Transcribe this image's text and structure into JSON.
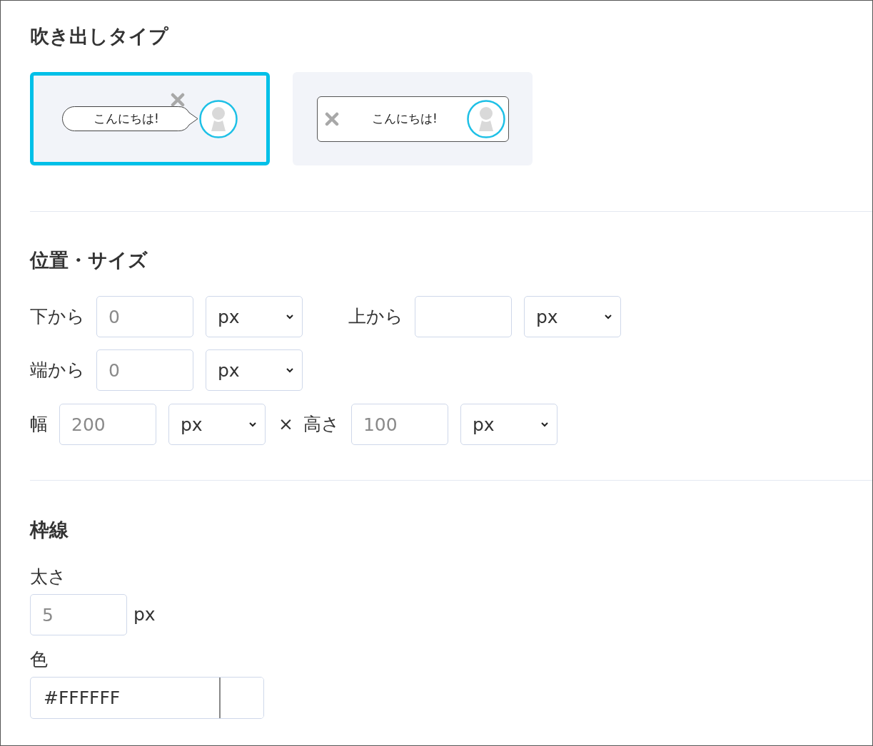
{
  "bubble_type": {
    "title": "吹き出しタイプ",
    "options": [
      {
        "kind": "bubble",
        "text": "こんにちは!",
        "selected": true
      },
      {
        "kind": "bar",
        "text": "こんにちは!",
        "selected": false
      }
    ]
  },
  "position_size": {
    "title": "位置・サイズ",
    "rows": [
      {
        "fields": [
          {
            "label": "下から",
            "placeholder": "0",
            "unit": "px"
          },
          {
            "label": "上から",
            "unit": "px"
          }
        ]
      },
      {
        "fields": [
          {
            "label": "端から",
            "placeholder": "0",
            "unit": "px"
          }
        ]
      },
      {
        "fields": [
          {
            "label": "幅",
            "placeholder": "200",
            "unit": "px"
          },
          {
            "separator": "×",
            "label": "高さ",
            "placeholder": "100",
            "unit": "px"
          }
        ]
      }
    ]
  },
  "border": {
    "title": "枠線",
    "thickness": {
      "label": "太さ",
      "placeholder": "5",
      "unit": "px"
    },
    "color": {
      "label": "色",
      "value": "#FFFFFF"
    }
  }
}
